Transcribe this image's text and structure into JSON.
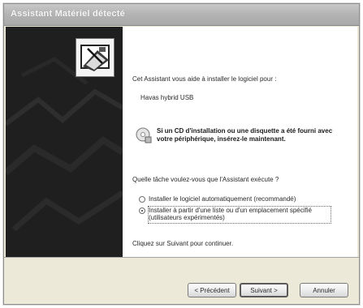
{
  "window": {
    "title": "Assistant Matériel détecté"
  },
  "content": {
    "intro": "Cet Assistant vous aide à installer le logiciel pour :",
    "device_name": "Havas hybrid USB",
    "cd_message": "Si un CD d'installation ou une disquette a été fourni avec votre périphérique, insérez-le maintenant.",
    "question": "Quelle tâche voulez-vous que l'Assistant exécute ?",
    "options": [
      {
        "label": "Installer le logiciel automatiquement (recommandé)",
        "selected": false
      },
      {
        "label": "Installer à partir d'une liste ou d'un emplacement spécifié (utilisateurs expérimentés)",
        "selected": true
      }
    ],
    "continue_text": "Cliquez sur Suivant pour continuer."
  },
  "buttons": {
    "back": "< Précédent",
    "next": "Suivant >",
    "cancel": "Annuler"
  },
  "icons": {
    "wizard": "hardware-wizard-icon",
    "info": "cd-info-icon"
  },
  "colors": {
    "side_panel": "#1f1f1f",
    "titlebar": "#b3b3b3",
    "frame": "#ece9d8"
  }
}
